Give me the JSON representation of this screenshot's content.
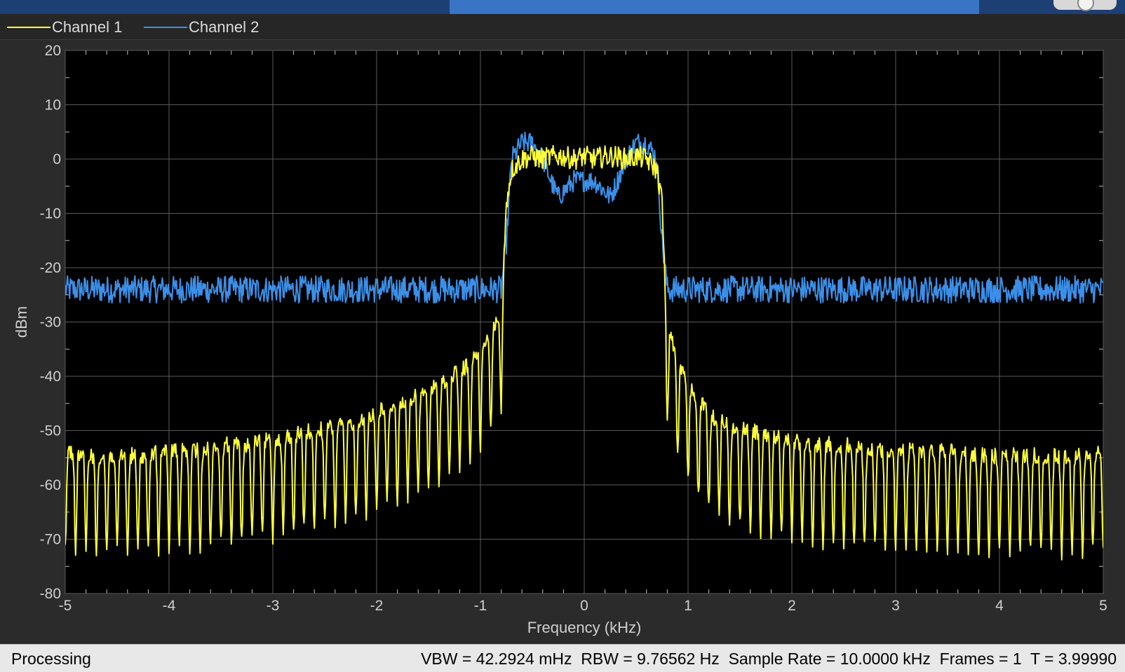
{
  "window": {
    "colors": {
      "title_bar": "#1e3f73",
      "active_tab": "#3a74c4"
    },
    "help_icon": "help-icon"
  },
  "legend": [
    {
      "name": "Channel 1",
      "color": "#ffff3a"
    },
    {
      "name": "Channel 2",
      "color": "#3b8fe8"
    }
  ],
  "status_bar": {
    "state": "Processing",
    "vbw": "VBW = 42.2924 mHz",
    "rbw": "RBW = 9.76562 Hz",
    "sample_rate": "Sample Rate = 10.0000 kHz",
    "frames": "Frames = 1",
    "time": "T = 3.99990"
  },
  "chart_data": {
    "type": "line",
    "title": "",
    "xlabel": "Frequency (kHz)",
    "ylabel": "dBm",
    "xlim": [
      -5,
      5
    ],
    "ylim": [
      -80,
      20
    ],
    "xticks": [
      -5,
      -4,
      -3,
      -2,
      -1,
      0,
      1,
      2,
      3,
      4,
      5
    ],
    "yticks": [
      20,
      10,
      0,
      -10,
      -20,
      -30,
      -40,
      -50,
      -60,
      -70,
      -80
    ],
    "grid": true,
    "background": "#000000",
    "legend_position": "top-left",
    "series": [
      {
        "name": "Channel 1",
        "color": "#ffff3a",
        "x": [
          -5,
          -4.75,
          -4.5,
          -4.25,
          -4,
          -3.75,
          -3.5,
          -3.25,
          -3,
          -2.75,
          -2.5,
          -2.25,
          -2,
          -1.75,
          -1.5,
          -1.25,
          -1.1,
          -1,
          -0.9,
          -0.8,
          -0.75,
          -0.7,
          -0.6,
          -0.5,
          -0.4,
          -0.3,
          -0.2,
          -0.1,
          0,
          0.1,
          0.2,
          0.3,
          0.4,
          0.5,
          0.6,
          0.7,
          0.75,
          0.8,
          0.9,
          1,
          1.1,
          1.25,
          1.5,
          1.75,
          2,
          2.25,
          2.5,
          2.75,
          3,
          3.25,
          3.5,
          3.75,
          4,
          4.25,
          4.5,
          4.75,
          5
        ],
        "values": [
          -53,
          -54,
          -54,
          -54,
          -53,
          -53,
          -52,
          -52,
          -51,
          -50,
          -49,
          -48,
          -46,
          -44,
          -42,
          -39,
          -37,
          -34,
          -31,
          -28,
          -8,
          -2,
          0,
          0.5,
          0,
          0.5,
          0.5,
          0,
          0.5,
          0,
          0.5,
          0.5,
          0,
          0.5,
          0,
          -2,
          -8,
          -30,
          -36,
          -41,
          -44,
          -47,
          -49,
          -50,
          -51,
          -52,
          -52,
          -53,
          -53,
          -53,
          -53,
          -54,
          -54,
          -54,
          -54,
          -54,
          -53
        ]
      },
      {
        "name": "Channel 2",
        "color": "#3b8fe8",
        "x": [
          -5,
          -4,
          -3,
          -2,
          -1,
          -0.9,
          -0.8,
          -0.75,
          -0.7,
          -0.6,
          -0.5,
          -0.4,
          -0.3,
          -0.25,
          -0.2,
          -0.1,
          0,
          0.1,
          0.2,
          0.25,
          0.3,
          0.4,
          0.5,
          0.6,
          0.7,
          0.75,
          0.8,
          0.9,
          1,
          2,
          3,
          4,
          5
        ],
        "values": [
          -24,
          -24,
          -24,
          -24,
          -24,
          -24,
          -24,
          -15,
          0,
          3,
          3,
          0,
          -5,
          -7,
          -6,
          -4,
          -4,
          -4,
          -6,
          -7,
          -5,
          0,
          3,
          3,
          0,
          -15,
          -24,
          -24,
          -24,
          -24,
          -24,
          -24,
          -24
        ]
      }
    ]
  }
}
